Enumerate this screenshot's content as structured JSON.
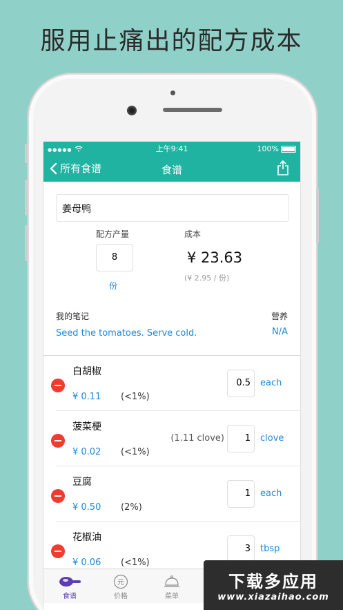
{
  "headline": "服用止痛出的配方成本",
  "status": {
    "signal": "●●●●●",
    "carrier": "",
    "time": "上午9:41",
    "battery": "100%"
  },
  "nav": {
    "back_label": "所有食谱",
    "title": "食谱"
  },
  "recipe": {
    "name": "姜母鸭",
    "yield_label": "配方产量",
    "yield_value": "8",
    "yield_unit": "份",
    "cost_label": "成本",
    "cost_value": "¥ 23.63",
    "cost_per": "(¥ 2.95 / 份)",
    "notes_label": "我的笔记",
    "notes_text": "Seed the tomatoes. Serve cold.",
    "nutrition_label": "营养",
    "nutrition_value": "N/A"
  },
  "ingredients": [
    {
      "name": "白胡椒",
      "price": "¥ 0.11",
      "pct": "(<1%)",
      "extra": "",
      "qty": "0.5",
      "unit": "each"
    },
    {
      "name": "菠菜梗",
      "price": "¥ 0.02",
      "pct": "(<1%)",
      "extra": "(1.11 clove)",
      "qty": "1",
      "unit": "clove"
    },
    {
      "name": "豆腐",
      "price": "¥ 0.50",
      "pct": "(2%)",
      "extra": "",
      "qty": "1",
      "unit": "each"
    },
    {
      "name": "花椒油",
      "price": "¥ 0.06",
      "pct": "(<1%)",
      "extra": "",
      "qty": "3",
      "unit": "tbsp"
    }
  ],
  "tabs": [
    {
      "label": "食谱",
      "icon": "pan-icon"
    },
    {
      "label": "价格",
      "icon": "yuan-coin-icon"
    },
    {
      "label": "菜单",
      "icon": "cloche-icon"
    }
  ],
  "watermark": {
    "top": "下载多应用",
    "bottom": "www.xiazaihao.com"
  },
  "colors": {
    "accent": "#20b3a1",
    "link": "#1e88d8",
    "delete": "#f03b2f",
    "tab_active": "#5b3fb1",
    "background": "#8fd1c9"
  }
}
